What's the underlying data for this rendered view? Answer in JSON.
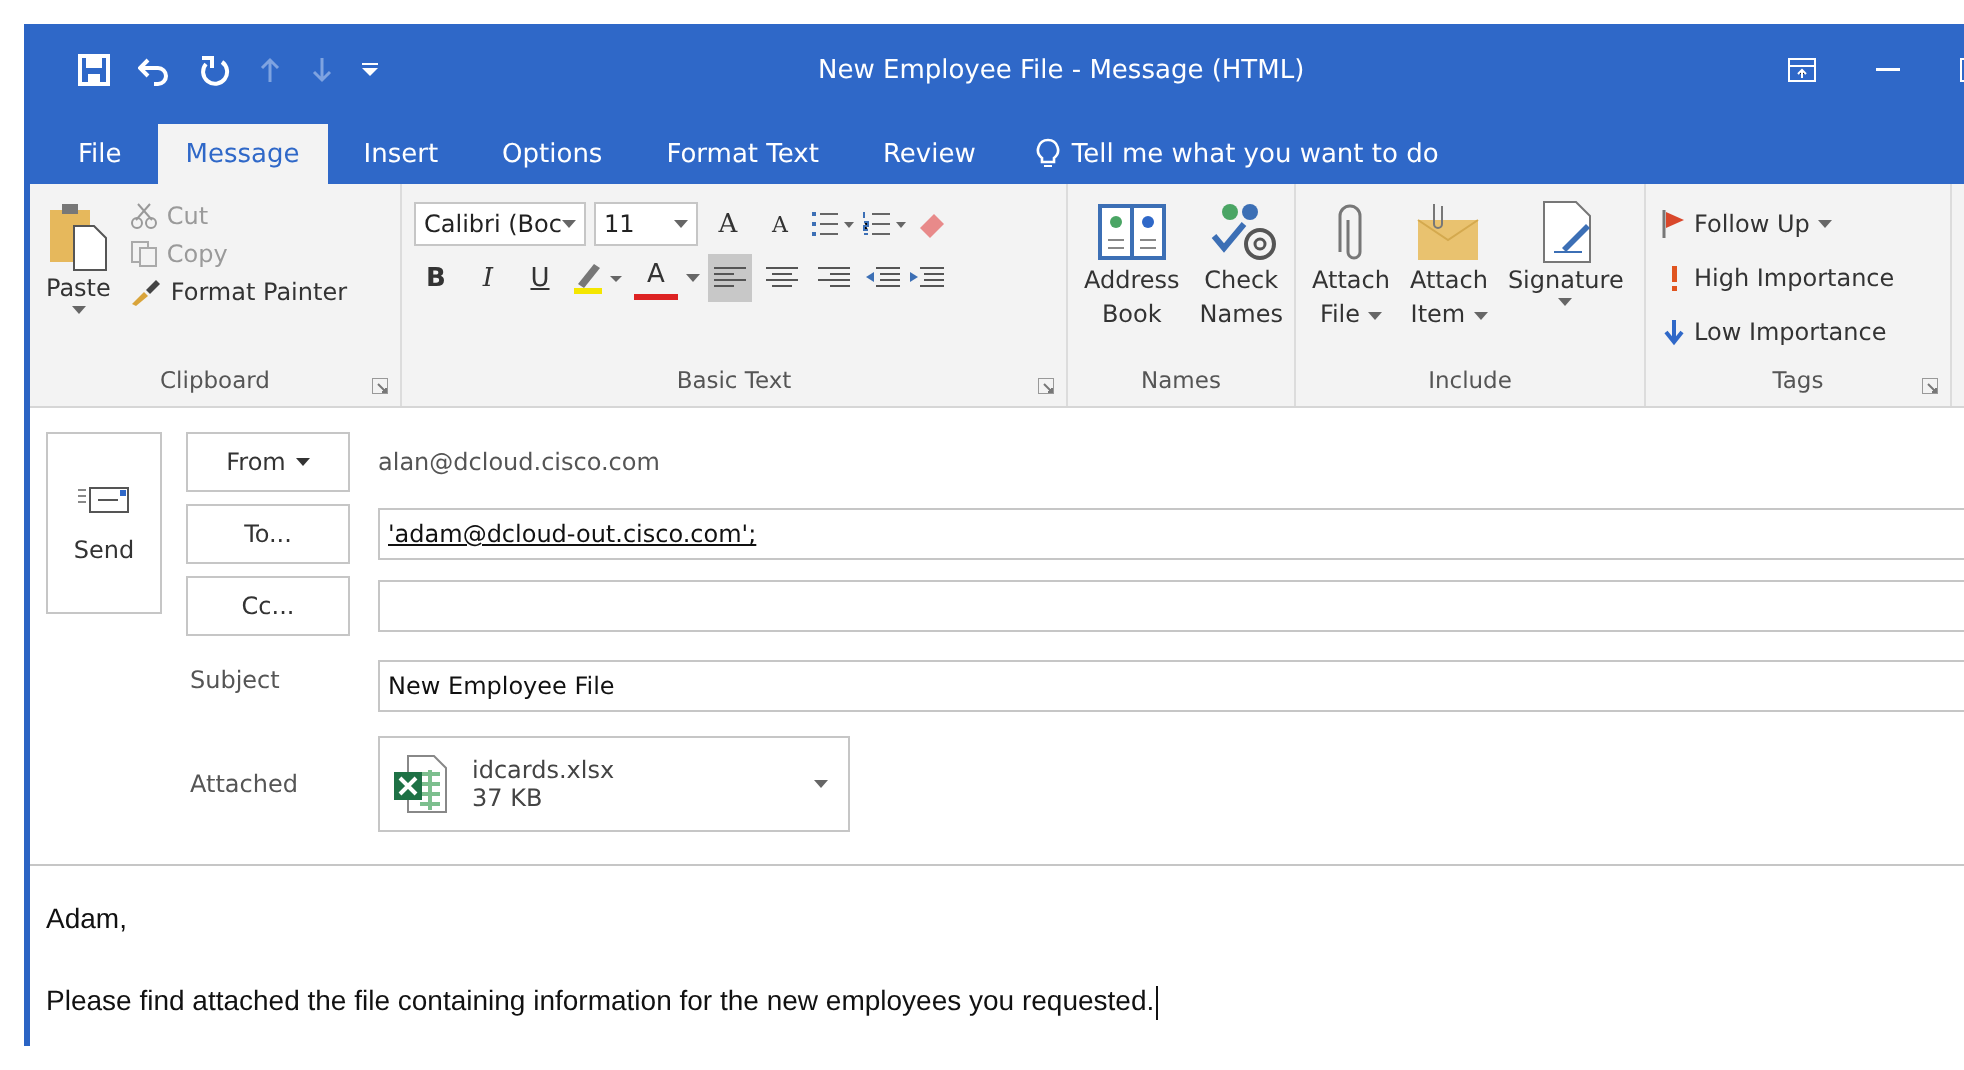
{
  "window": {
    "title": "New Employee File  -  Message (HTML)"
  },
  "tabs": [
    {
      "label": "File",
      "selected": false
    },
    {
      "label": "Message",
      "selected": true
    },
    {
      "label": "Insert",
      "selected": false
    },
    {
      "label": "Options",
      "selected": false
    },
    {
      "label": "Format Text",
      "selected": false
    },
    {
      "label": "Review",
      "selected": false
    }
  ],
  "tell_me": "Tell me what you want to do",
  "clipboard": {
    "label": "Clipboard",
    "paste": "Paste",
    "items": [
      {
        "kind": "cut",
        "label": "Cut",
        "disabled": true
      },
      {
        "kind": "copy",
        "label": "Copy",
        "disabled": true
      },
      {
        "kind": "painter",
        "label": "Format Painter",
        "disabled": false
      }
    ]
  },
  "basic_text": {
    "label": "Basic Text",
    "font": "Calibri (Boc",
    "size": "11",
    "grow": "A",
    "shrink": "A",
    "bold": "B",
    "italic": "I",
    "underline": "U",
    "font_color": "A",
    "align": [
      {
        "selected": true
      },
      {
        "selected": false
      },
      {
        "selected": false
      }
    ]
  },
  "names": {
    "label": "Names",
    "buttons": [
      {
        "kind": "book",
        "lines": [
          "Address",
          "Book"
        ],
        "has_menu": false
      },
      {
        "kind": "check",
        "lines": [
          "Check",
          "Names"
        ],
        "has_menu": false
      }
    ]
  },
  "include": {
    "label": "Include",
    "buttons": [
      {
        "kind": "clip",
        "lines": [
          "Attach",
          "File"
        ],
        "has_menu": true
      },
      {
        "kind": "envelope",
        "lines": [
          "Attach",
          "Item"
        ],
        "has_menu": true
      },
      {
        "kind": "signature",
        "lines": [
          "Signature"
        ],
        "has_menu": true
      }
    ]
  },
  "tags": {
    "label": "Tags",
    "items": [
      {
        "kind": "flag",
        "label": "Follow Up",
        "has_menu": true
      },
      {
        "kind": "high",
        "label": "High Importance",
        "has_menu": false
      },
      {
        "kind": "low",
        "label": "Low Importance",
        "has_menu": false
      }
    ]
  },
  "send": "Send",
  "from": {
    "button": "From",
    "value": "alan@dcloud.cisco.com"
  },
  "to": {
    "button": "To...",
    "value": "'adam@dcloud-out.cisco.com';"
  },
  "cc": {
    "button": "Cc..."
  },
  "subject": {
    "label": "Subject",
    "value": "New Employee File"
  },
  "attachment": {
    "label": "Attached",
    "name": "idcards.xlsx",
    "size": "37 KB"
  },
  "body": [
    "Adam,",
    "Please find attached the file containing information for the new employees you requested."
  ]
}
